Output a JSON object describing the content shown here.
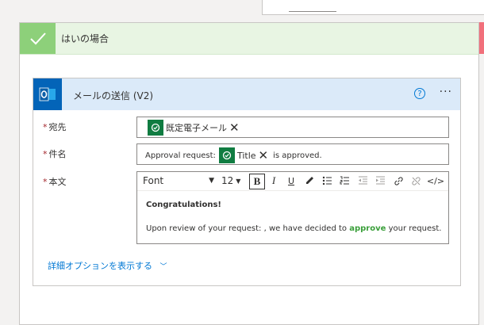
{
  "branch": {
    "title": "はいの場合",
    "check_icon": "checkmark-icon",
    "accent": "#8dd07a"
  },
  "action": {
    "title": "メールの送信 (V2)",
    "app_icon": "outlook-icon",
    "help_label": "?",
    "more_label": "···"
  },
  "fields": {
    "to": {
      "label": "宛先",
      "required": "*",
      "token": "既定電子メール",
      "token_icon": "approval-icon"
    },
    "subject": {
      "label": "件名",
      "required": "*",
      "prefix": "Approval request:",
      "token": "Title",
      "suffix": "is approved."
    },
    "body": {
      "label": "本文",
      "required": "*",
      "toolbar": {
        "font": "Font",
        "size": "12",
        "bold": "B",
        "italic": "I",
        "underline": "U",
        "code": "</>"
      },
      "heading": "Congratulations!",
      "line_prefix": "Upon review of your request: , we have decided to",
      "line_highlight": "approve",
      "line_suffix": "your request.",
      "highlight_color": "#3a9f3a"
    }
  },
  "advanced_link": "詳細オプションを表示する"
}
